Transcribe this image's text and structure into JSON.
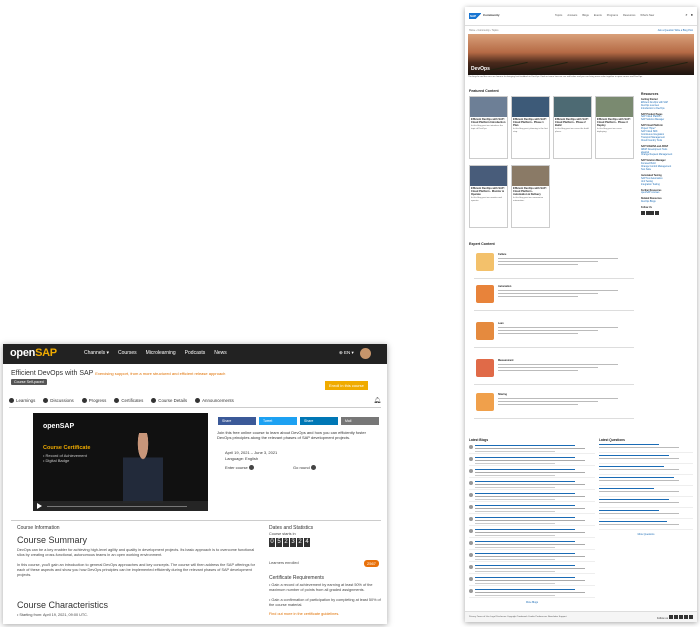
{
  "sap_community": {
    "logo_text": "SAP",
    "community_label": "Community",
    "nav": [
      "Topics",
      "Answers",
      "Blogs",
      "Events",
      "Programs",
      "Resources",
      "What's New"
    ],
    "breadcrumb": "Home › Community › Topics",
    "breadcrumb_right": "Ask a Question  Write a Blog Post",
    "hero_title": "DevOps",
    "hero_caption": "The bicycle and the race are famous for bringing fast feedback in DevOps. Find out more how we can add value and you can bring more value together in open source and DevOps.",
    "featured_heading": "Featured Content",
    "cards": [
      {
        "title": "Efficient DevOps with SAP: Cloud Platform Introduction",
        "desc": "In this blog post we introduce the topic of DevOps."
      },
      {
        "title": "Efficient DevOps with SAP: Cloud Platform - Phase 1 Plan",
        "desc": "In this blog post, planning is the first step."
      },
      {
        "title": "Efficient DevOps with SAP: Cloud Platform - Phase 2 Build",
        "desc": "In this blog post we cover the build phase."
      },
      {
        "title": "Efficient DevOps with SAP: Cloud Platform - Phase 3 Deploy",
        "desc": "In this blog post we cover deploying."
      },
      {
        "title": "Efficient DevOps with SAP: Cloud Platform - Monitor & Operate",
        "desc": "In this blog post we monitor and operate."
      },
      {
        "title": "Efficient DevOps with SAP: Cloud Platform - Automation & Delivery",
        "desc": "In this blog post we summarize automation."
      }
    ],
    "expert_heading": "Expert Content",
    "expert_items": [
      "Culture",
      "Automation",
      "Lean",
      "Measurement",
      "Sharing"
    ],
    "resources_heading": "Resources",
    "resources": [
      {
        "head": "Getting Started",
        "links": [
          "Efficient DevOps with SAP",
          "DevOps overview",
          "Introduction to DevOps"
        ]
      },
      {
        "head": "SAP Product Pages",
        "links": [
          "SAP Cloud Platform",
          "SAP Solution Manager"
        ]
      },
      {
        "head": "SAP Cloud Platform",
        "links": [
          "Project \"Piper\"",
          "SAP Cloud SDK",
          "Continuous Integration",
          "Transport Management",
          "Cloud Foundry Tools"
        ]
      },
      {
        "head": "SAP S/4HANA and ABAP",
        "links": [
          "ABAP Development Tools",
          "abapGit",
          "Change Request Management"
        ]
      },
      {
        "head": "SAP Solution Manager",
        "links": [
          "Focused Build",
          "Change Control Management",
          "Test Suite"
        ]
      },
      {
        "head": "Automated Testing",
        "links": [
          "SAP Test Automation",
          "Unit Testing",
          "Integration Testing"
        ]
      },
      {
        "head": "Further Resources",
        "links": [
          "openSAP courses"
        ]
      },
      {
        "head": "Related Resources",
        "links": [
          "DevOps Blogs"
        ]
      },
      {
        "head": "Follow Us",
        "links": []
      }
    ],
    "blogs_heading": "Latest Blogs",
    "blogs_more": "More Blogs",
    "questions_heading": "Latest Questions",
    "questions_more": "More Questions",
    "footer_left": "Privacy  Terms of Use  Legal Disclosure  Copyright  Trademark  Cookie Preferences  Newsletter  Support",
    "footer_right": "Follow us"
  },
  "opensap": {
    "brand_open": "open",
    "brand_sap": "SAP",
    "nav": [
      "Channels ▾",
      "Courses",
      "Microlearning",
      "Podcasts",
      "News"
    ],
    "lang": "⊕ EN ▾",
    "course_title": "Efficient DevOps with SAP",
    "course_sub": "Exercising support, from a more structured and efficient release approach",
    "course_pill": "Course Self-paced",
    "enroll": "Enroll in this course",
    "tabs": [
      "Learnings",
      "Discussions",
      "Progress",
      "Certificates",
      "Course Details",
      "Announcements"
    ],
    "video": {
      "brand": "openSAP",
      "cert": "Course Certificate",
      "bullets": [
        "• Record of Achievement",
        "• Digital Badge"
      ]
    },
    "share": [
      "Share",
      "Tweet",
      "Share",
      "Mail"
    ],
    "share_colors": [
      "#3b5998",
      "#1da1f2",
      "#0077b5",
      "#777777"
    ],
    "description": "Join this free online course to learn about DevOps and how you can efficiently foster DevOps principles along the relevant phases of SAP development projects.",
    "dates": "April 19, 2021 – June 3, 2021",
    "language": "Language: English",
    "enroll_course": "Enter course",
    "go_round": "Go round",
    "course_info": "Course Information",
    "summary_h": "Course Summary",
    "summary_p1": "DevOps can be a key enabler for achieving high-level agility and quality in development projects. Its basic approach is to overcome functional silos by creating cross-functional, autonomous teams in an open working environment.",
    "summary_p2": "In this course, you'll gain an introduction to general DevOps approaches and key concepts. The course will then address the SAP offerings for each of these aspects and show you how DevOps principles can be implemented efficiently during the relevant phases of SAP development projects.",
    "characteristics_h": "Course Characteristics",
    "characteristics_p": "• Starting from: April 19, 2021, 09:00 UTC.",
    "stats_h": "Dates and Statistics",
    "course_starts": "Course starts in",
    "digits": [
      "0",
      "5",
      "2",
      "3",
      "2",
      "4"
    ],
    "learners": "Learners enrolled",
    "learners_count": "2567",
    "cert_h": "Certificate Requirements",
    "cert_items": [
      "• Gain a record of achievement by earning at least 50% of the maximum number of points from all graded assignments.",
      "• Gain a confirmation of participation by completing at least 50% of the course material."
    ],
    "cert_more": "Find out more in the certificate guidelines."
  }
}
